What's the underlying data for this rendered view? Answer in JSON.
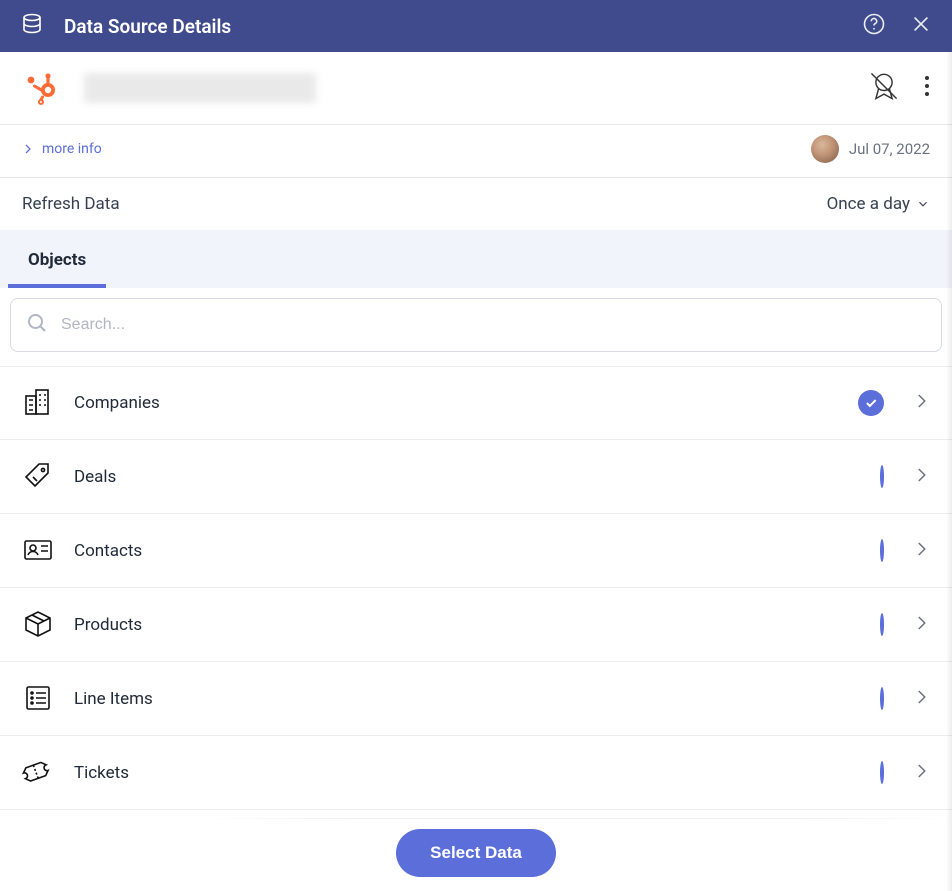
{
  "header": {
    "title": "Data Source Details"
  },
  "moreInfo": {
    "label": "more info",
    "date": "Jul 07, 2022"
  },
  "refresh": {
    "label": "Refresh Data",
    "selected": "Once a day"
  },
  "tabs": {
    "active": "Objects"
  },
  "search": {
    "placeholder": "Search..."
  },
  "objects": [
    {
      "name": "Companies",
      "icon": "buildings",
      "selected": true
    },
    {
      "name": "Deals",
      "icon": "pricetag",
      "selected": false
    },
    {
      "name": "Contacts",
      "icon": "idcard",
      "selected": false
    },
    {
      "name": "Products",
      "icon": "box",
      "selected": false
    },
    {
      "name": "Line Items",
      "icon": "listdoc",
      "selected": false
    },
    {
      "name": "Tickets",
      "icon": "ticket",
      "selected": false
    }
  ],
  "actions": {
    "primary": "Select Data"
  }
}
